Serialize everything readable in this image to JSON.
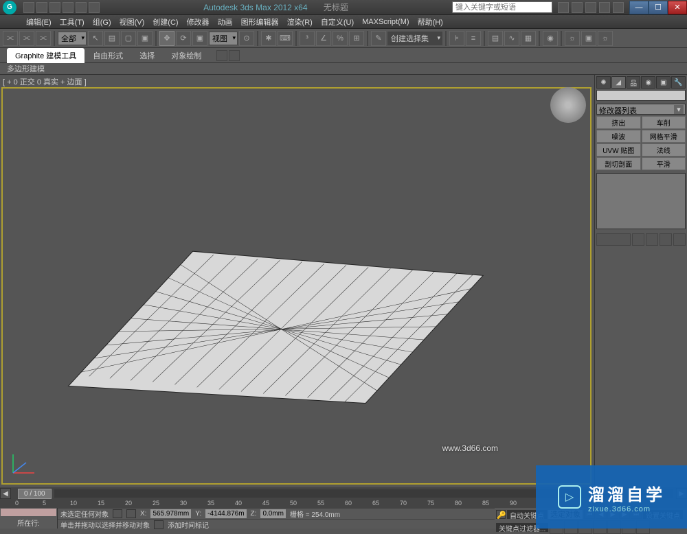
{
  "titlebar": {
    "app_title": "Autodesk 3ds Max 2012 x64",
    "untitled": "无标题",
    "search_placeholder": "键入关键字或短语"
  },
  "window_controls": {
    "min": "—",
    "max": "☐",
    "close": "✕"
  },
  "menubar": {
    "items": [
      "编辑(E)",
      "工具(T)",
      "组(G)",
      "视图(V)",
      "创建(C)",
      "修改器",
      "动画",
      "图形编辑器",
      "渲染(R)",
      "自定义(U)",
      "MAXScript(M)",
      "帮助(H)"
    ]
  },
  "toolbar": {
    "all_dropdown": "全部",
    "view_dropdown": "视图",
    "selection_set": "创建选择集"
  },
  "ribbon": {
    "tabs": [
      "Graphite 建模工具",
      "自由形式",
      "选择",
      "对象绘制"
    ],
    "subrow": "多边形建模"
  },
  "viewport": {
    "label": "[ + 0 正交 0 真实 + 边面 ]"
  },
  "cmdpanel": {
    "modlist_label": "修改器列表",
    "presets": [
      "挤出",
      "车削",
      "噪波",
      "网格平滑",
      "UVW 贴图",
      "法线",
      "剖切剖面",
      "平滑"
    ]
  },
  "timeslider": {
    "handle": "0 / 100"
  },
  "ruler": {
    "ticks": [
      0,
      5,
      10,
      15,
      20,
      25,
      30,
      35,
      40,
      45,
      50,
      55,
      60,
      65,
      70,
      75,
      80,
      85,
      90
    ]
  },
  "statusbar": {
    "left_label": "所在行:",
    "msg1": "未选定任何对象",
    "msg2": "单击并拖动以选择并移动对象",
    "x_value": "565.978mm",
    "y_value": "-4144.876m",
    "z_value": "0.0mm",
    "grid_label": "栅格 = 254.0mm",
    "autokey": "自动关键点",
    "sel_set": "选定对象",
    "setkey": "设置关键点",
    "keyfilter": "关键点过滤器...",
    "addtimetag": "添加时间标记"
  },
  "watermark": {
    "url": "www.3d66.com",
    "cn": "溜溜自学",
    "en": "zixue.3d66.com"
  }
}
